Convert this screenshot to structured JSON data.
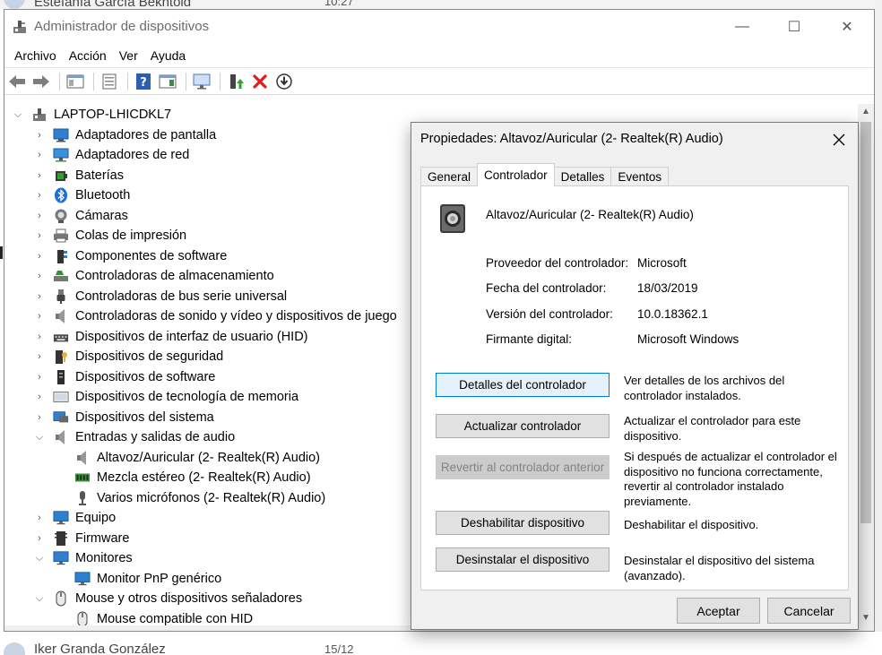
{
  "background": {
    "top_item": {
      "name": "Estefanía García Bekhtold",
      "time": "10:27"
    },
    "bottom_item": {
      "name": "Iker Granda González",
      "time": "15/12"
    }
  },
  "window": {
    "title": "Administrador de dispositivos",
    "icon": "device-manager-icon",
    "controls": {
      "minimize": "—",
      "maximize": "☐",
      "close": "✕"
    }
  },
  "menu": [
    "Archivo",
    "Acción",
    "Ver",
    "Ayuda"
  ],
  "toolbar": [
    "back-icon",
    "forward-icon",
    "show-hide-console-tree-icon",
    "properties-icon",
    "help-icon",
    "action-pane-icon",
    "scan-hardware-icon",
    "update-driver-icon",
    "uninstall-icon",
    "disable-icon"
  ],
  "tree": {
    "root": "LAPTOP-LHICDKL7",
    "items": [
      {
        "label": "Adaptadores de pantalla",
        "expanded": false,
        "icon": "display-adapter-icon"
      },
      {
        "label": "Adaptadores de red",
        "expanded": false,
        "icon": "network-adapter-icon"
      },
      {
        "label": "Baterías",
        "expanded": false,
        "icon": "battery-icon"
      },
      {
        "label": "Bluetooth",
        "expanded": false,
        "icon": "bluetooth-icon"
      },
      {
        "label": "Cámaras",
        "expanded": false,
        "icon": "camera-icon"
      },
      {
        "label": "Colas de impresión",
        "expanded": false,
        "icon": "printer-icon"
      },
      {
        "label": "Componentes de software",
        "expanded": false,
        "icon": "software-component-icon"
      },
      {
        "label": "Controladoras de almacenamiento",
        "expanded": false,
        "icon": "storage-controller-icon"
      },
      {
        "label": "Controladoras de bus serie universal",
        "expanded": false,
        "icon": "usb-icon"
      },
      {
        "label": "Controladoras de sonido y vídeo y dispositivos de juego",
        "expanded": false,
        "icon": "speaker-icon"
      },
      {
        "label": "Dispositivos de interfaz de usuario (HID)",
        "expanded": false,
        "icon": "hid-icon"
      },
      {
        "label": "Dispositivos de seguridad",
        "expanded": false,
        "icon": "security-device-icon"
      },
      {
        "label": "Dispositivos de software",
        "expanded": false,
        "icon": "software-device-icon"
      },
      {
        "label": "Dispositivos de tecnología de memoria",
        "expanded": false,
        "icon": "memory-device-icon"
      },
      {
        "label": "Dispositivos del sistema",
        "expanded": false,
        "icon": "system-device-icon"
      },
      {
        "label": "Entradas y salidas de audio",
        "expanded": true,
        "icon": "audio-io-icon",
        "children": [
          {
            "label": "Altavoz/Auricular (2- Realtek(R) Audio)",
            "icon": "speaker-icon"
          },
          {
            "label": "Mezcla estéreo (2- Realtek(R) Audio)",
            "icon": "stereo-mix-icon"
          },
          {
            "label": "Varios micrófonos (2- Realtek(R) Audio)",
            "icon": "microphone-icon"
          }
        ]
      },
      {
        "label": "Equipo",
        "expanded": false,
        "icon": "computer-icon"
      },
      {
        "label": "Firmware",
        "expanded": false,
        "icon": "firmware-icon"
      },
      {
        "label": "Monitores",
        "expanded": true,
        "icon": "monitor-icon",
        "children": [
          {
            "label": "Monitor PnP genérico",
            "icon": "monitor-icon"
          }
        ]
      },
      {
        "label": "Mouse y otros dispositivos señaladores",
        "expanded": true,
        "icon": "mouse-icon",
        "children": [
          {
            "label": "Mouse compatible con HID",
            "icon": "mouse-icon"
          }
        ]
      }
    ]
  },
  "dialog": {
    "title": "Propiedades: Altavoz/Auricular (2- Realtek(R) Audio)",
    "tabs": [
      "General",
      "Controlador",
      "Detalles",
      "Eventos"
    ],
    "active_tab": "Controlador",
    "device_name": "Altavoz/Auricular (2- Realtek(R) Audio)",
    "properties": [
      {
        "label": "Proveedor del controlador:",
        "value": "Microsoft"
      },
      {
        "label": "Fecha del controlador:",
        "value": "18/03/2019"
      },
      {
        "label": "Versión del controlador:",
        "value": "10.0.18362.1"
      },
      {
        "label": "Firmante digital:",
        "value": "Microsoft Windows"
      }
    ],
    "actions": [
      {
        "button": "Detalles del controlador",
        "description": "Ver detalles de los archivos del controlador instalados.",
        "state": "focused"
      },
      {
        "button": "Actualizar controlador",
        "description": "Actualizar el controlador para este dispositivo.",
        "state": "enabled"
      },
      {
        "button": "Revertir al controlador anterior",
        "description": "Si después de actualizar el controlador el dispositivo no funciona correctamente, revertir al controlador instalado previamente.",
        "state": "disabled"
      },
      {
        "button": "Deshabilitar dispositivo",
        "description": "Deshabilitar el dispositivo.",
        "state": "enabled"
      },
      {
        "button": "Desinstalar el dispositivo",
        "description": "Desinstalar el dispositivo del sistema (avanzado).",
        "state": "enabled"
      }
    ],
    "ok_label": "Aceptar",
    "cancel_label": "Cancelar"
  },
  "colors": {
    "accent": "#0078d7",
    "disabled_text": "#838383",
    "title_text": "#6b6b6b"
  }
}
